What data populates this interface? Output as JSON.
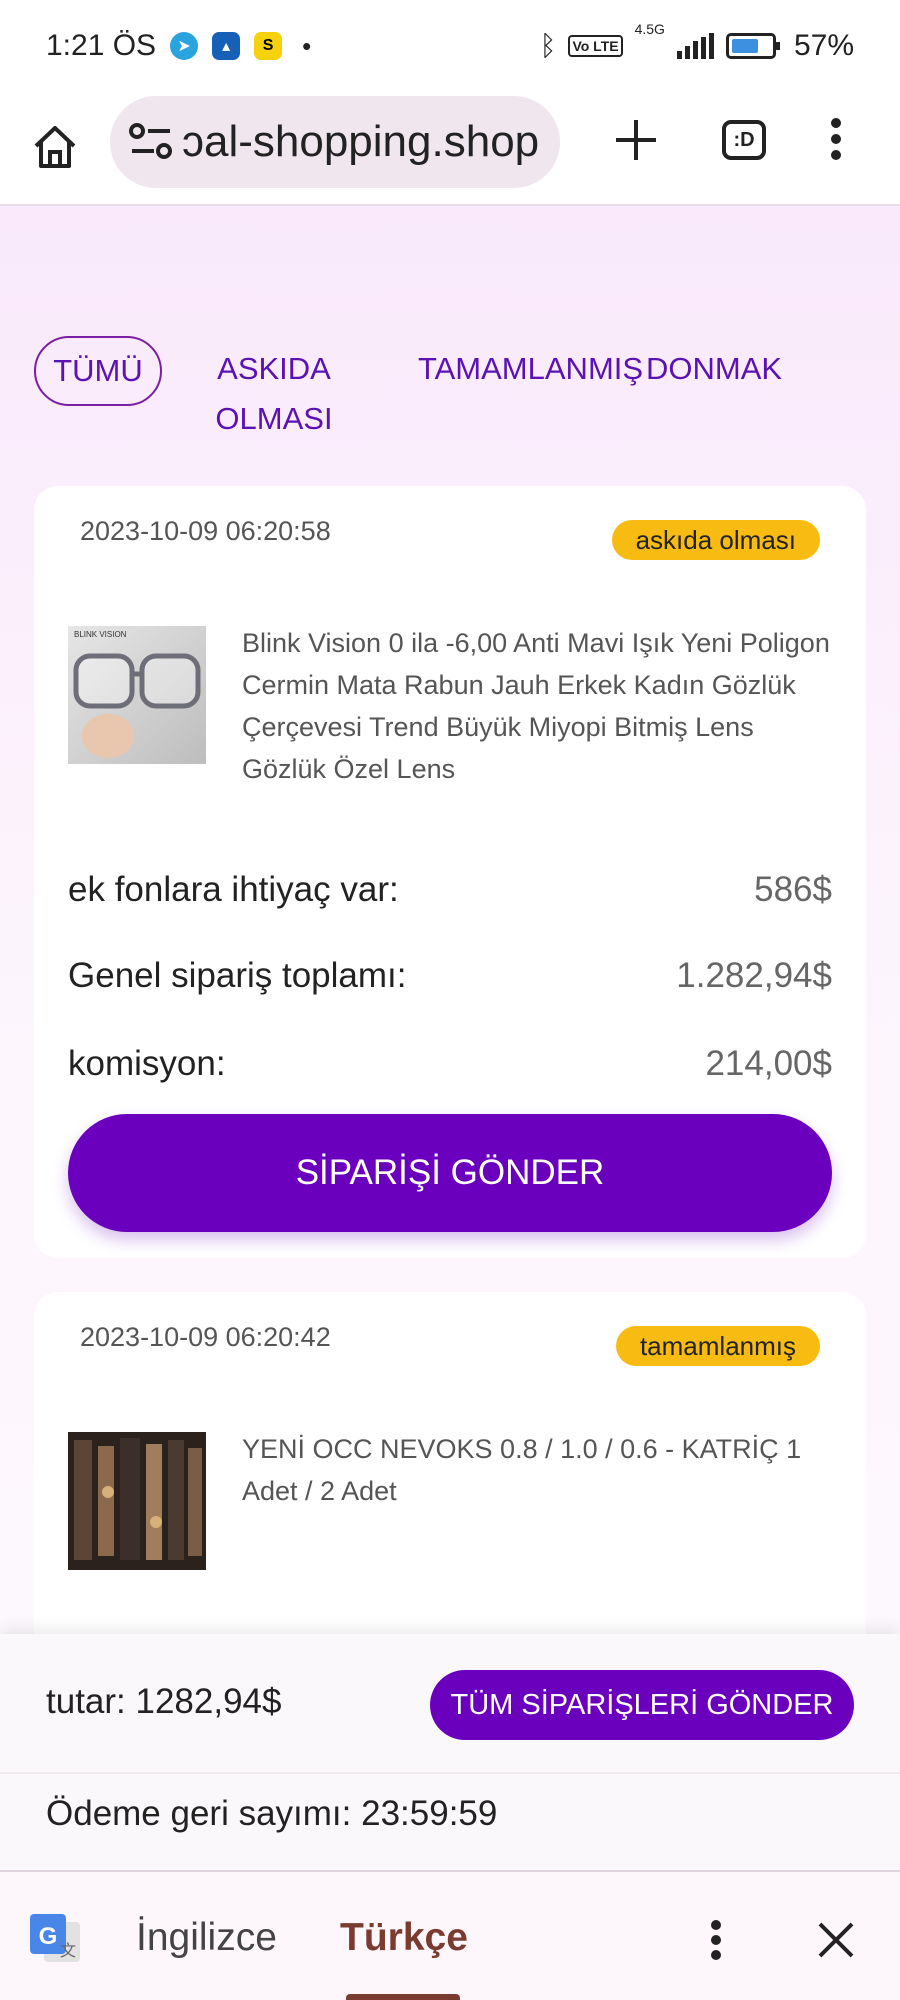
{
  "status_bar": {
    "time": "1:21 ÖS",
    "network": "4.5G",
    "battery": "57%"
  },
  "browser": {
    "url": "ɔal-shopping.shop",
    "tab_switcher_label": ":D"
  },
  "tabs": [
    {
      "label": "TÜMÜ",
      "active": true
    },
    {
      "label": "ASKIDA OLMASI",
      "active": false
    },
    {
      "label": "TAMAMLANMIŞ",
      "active": false
    },
    {
      "label": "DONMAK",
      "active": false
    }
  ],
  "orders": [
    {
      "date": "2023-10-09 06:20:58",
      "status": "askıda olması",
      "product_name": "Blink Vision 0 ila -6,00 Anti Mavi Işık Yeni Poligon Cermin Mata Rabun Jauh Erkek Kadın Gözlük Çerçevesi Trend Büyük Miyopi Bitmiş Lens Gözlük Özel Lens",
      "thumb_caption": "BLINK VISION",
      "rows": [
        {
          "label": "ek fonlara ihtiyaç var:",
          "value": "586$"
        },
        {
          "label": "Genel sipariş toplamı:",
          "value": "1.282,94$"
        },
        {
          "label": "komisyon:",
          "value": "214,00$"
        }
      ],
      "submit_label": "SİPARİŞİ GÖNDER"
    },
    {
      "date": "2023-10-09 06:20:42",
      "status": "tamamlanmış",
      "product_name": "YENİ OCC NEVOKS 0.8 / 1.0 / 0.6 - KATRİÇ 1 Adet / 2 Adet"
    }
  ],
  "footer": {
    "amount": "tutar: 1282,94$",
    "send_all_label": "TÜM SİPARİŞLERİ GÖNDER",
    "countdown": "Ödeme geri sayımı: 23:59:59"
  },
  "translate_bar": {
    "source_language": "İngilizce",
    "target_language": "Türkçe"
  },
  "colors": {
    "accent": "#6a00be",
    "badge": "#f8bb12",
    "tab_text": "#5b12b3"
  }
}
